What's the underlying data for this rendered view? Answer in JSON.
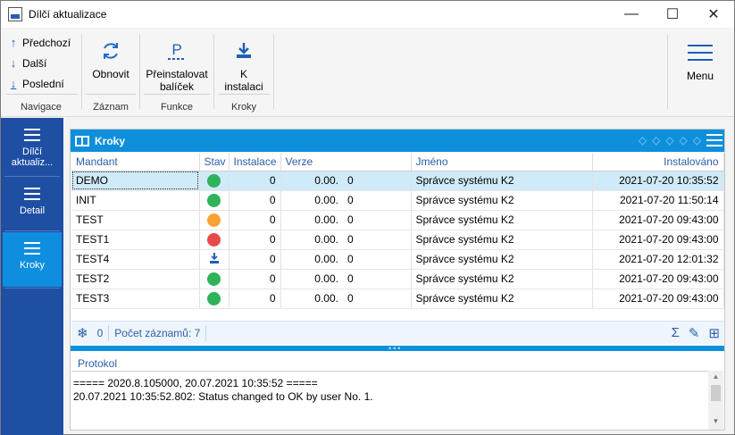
{
  "window": {
    "title": "Dílčí aktualizace",
    "buttons": {
      "minimize": "—",
      "maximize": "☐",
      "close": "✕"
    }
  },
  "ribbon": {
    "navigation": {
      "items": [
        {
          "label": "Předchozí",
          "icon": "arrow-up-icon"
        },
        {
          "label": "Další",
          "icon": "arrow-down-icon"
        },
        {
          "label": "Poslední",
          "icon": "arrow-last-icon"
        }
      ],
      "group_label": "Navigace"
    },
    "record": {
      "button_label": "Obnovit",
      "group_label": "Záznam"
    },
    "functions": {
      "button_line1": "Přeinstalovat",
      "button_line2": "balíček",
      "group_label": "Funkce"
    },
    "steps": {
      "button_line1": "K",
      "button_line2": "instalaci",
      "group_label": "Kroky"
    },
    "menu_label": "Menu"
  },
  "sidebar": {
    "items": [
      {
        "label_line1": "Dílčí",
        "label_line2": "aktualiz..."
      },
      {
        "label_line1": "Detail",
        "label_line2": ""
      },
      {
        "label_line1": "Kroky",
        "label_line2": "",
        "active": true
      }
    ]
  },
  "panel": {
    "title": "Kroky",
    "columns": [
      "Mandant",
      "Stav",
      "Instalace",
      "Verze",
      "Jméno",
      "Instalováno"
    ],
    "rows": [
      {
        "mandant": "DEMO",
        "stav": "green",
        "instalace": "0",
        "verze_a": "0.00.",
        "verze_b": "0",
        "jmeno": "Správce systému K2",
        "instalovano": "2021-07-20 10:35:52"
      },
      {
        "mandant": "INIT",
        "stav": "green",
        "instalace": "0",
        "verze_a": "0.00.",
        "verze_b": "0",
        "jmeno": "Správce systému K2",
        "instalovano": "2021-07-20 11:50:14"
      },
      {
        "mandant": "TEST",
        "stav": "orange",
        "instalace": "0",
        "verze_a": "0.00.",
        "verze_b": "0",
        "jmeno": "Správce systému K2",
        "instalovano": "2021-07-20 09:43:00"
      },
      {
        "mandant": "TEST1",
        "stav": "red",
        "instalace": "0",
        "verze_a": "0.00.",
        "verze_b": "0",
        "jmeno": "Správce systému K2",
        "instalovano": "2021-07-20 09:43:00"
      },
      {
        "mandant": "TEST4",
        "stav": "install-icon",
        "instalace": "0",
        "verze_a": "0.00.",
        "verze_b": "0",
        "jmeno": "Správce systému K2",
        "instalovano": "2021-07-20 12:01:32"
      },
      {
        "mandant": "TEST2",
        "stav": "green",
        "instalace": "0",
        "verze_a": "0.00.",
        "verze_b": "0",
        "jmeno": "Správce systému K2",
        "instalovano": "2021-07-20 09:43:00"
      },
      {
        "mandant": "TEST3",
        "stav": "green",
        "instalace": "0",
        "verze_a": "0.00.",
        "verze_b": "0",
        "jmeno": "Správce systému K2",
        "instalovano": "2021-07-20 09:43:00"
      }
    ],
    "status": {
      "filter_count": "0",
      "record_count": "Počet záznamů: 7"
    }
  },
  "protokol": {
    "label": "Protokol",
    "lines": [
      "===== 2020.8.105000, 20.07.2021 10:35:52 =====",
      "20.07.2021 10:35:52.802: Status changed to OK by user No. 1."
    ]
  },
  "colors": {
    "accent": "#0e8fdc",
    "sidebar": "#1f4fa3",
    "green": "#2eb35a",
    "orange": "#f7a234",
    "red": "#e84a4a",
    "selected_row": "#cfeaf8"
  }
}
